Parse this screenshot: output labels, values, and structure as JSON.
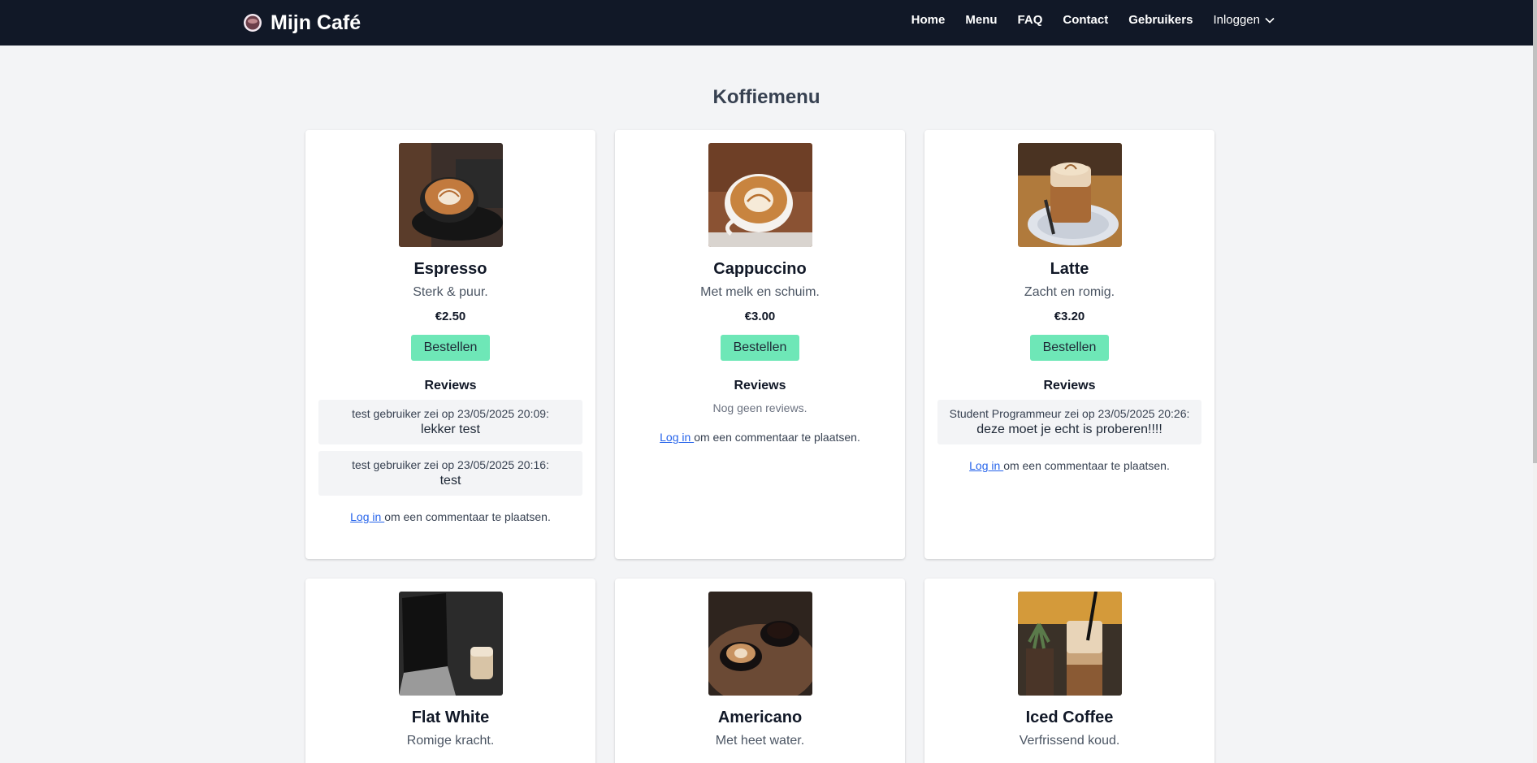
{
  "navbar": {
    "brand": "Mijn Café",
    "links": [
      "Home",
      "Menu",
      "FAQ",
      "Contact",
      "Gebruikers"
    ],
    "login_dropdown": "Inloggen"
  },
  "page": {
    "title": "Koffiemenu"
  },
  "labels": {
    "order_button": "Bestellen",
    "reviews_heading": "Reviews",
    "no_reviews": "Nog geen reviews.",
    "login_link": "Log in ",
    "login_suffix": "om een commentaar te plaatsen."
  },
  "products": [
    {
      "name": "Espresso",
      "description": "Sterk & puur.",
      "price": "€2.50",
      "image": "espresso-photo",
      "reviews": [
        {
          "meta": "test gebruiker zei op 23/05/2025 20:09:",
          "text": "lekker test"
        },
        {
          "meta": "test gebruiker zei op 23/05/2025 20:16:",
          "text": "test"
        }
      ]
    },
    {
      "name": "Cappuccino",
      "description": "Met melk en schuim.",
      "price": "€3.00",
      "image": "cappuccino-photo",
      "reviews": []
    },
    {
      "name": "Latte",
      "description": "Zacht en romig.",
      "price": "€3.20",
      "image": "latte-photo",
      "reviews": [
        {
          "meta": "Student Programmeur zei op 23/05/2025 20:26:",
          "text": "deze moet je echt is proberen!!!!"
        }
      ]
    },
    {
      "name": "Flat White",
      "description": "Romige kracht.",
      "image": "flat-white-photo"
    },
    {
      "name": "Americano",
      "description": "Met heet water.",
      "image": "americano-photo"
    },
    {
      "name": "Iced Coffee",
      "description": "Verfrissend koud.",
      "image": "iced-coffee-photo"
    }
  ],
  "colors": {
    "navbar": "#111827",
    "page_background": "#f3f4f6",
    "order_button": "#6ee7b7",
    "link": "#2563eb"
  }
}
